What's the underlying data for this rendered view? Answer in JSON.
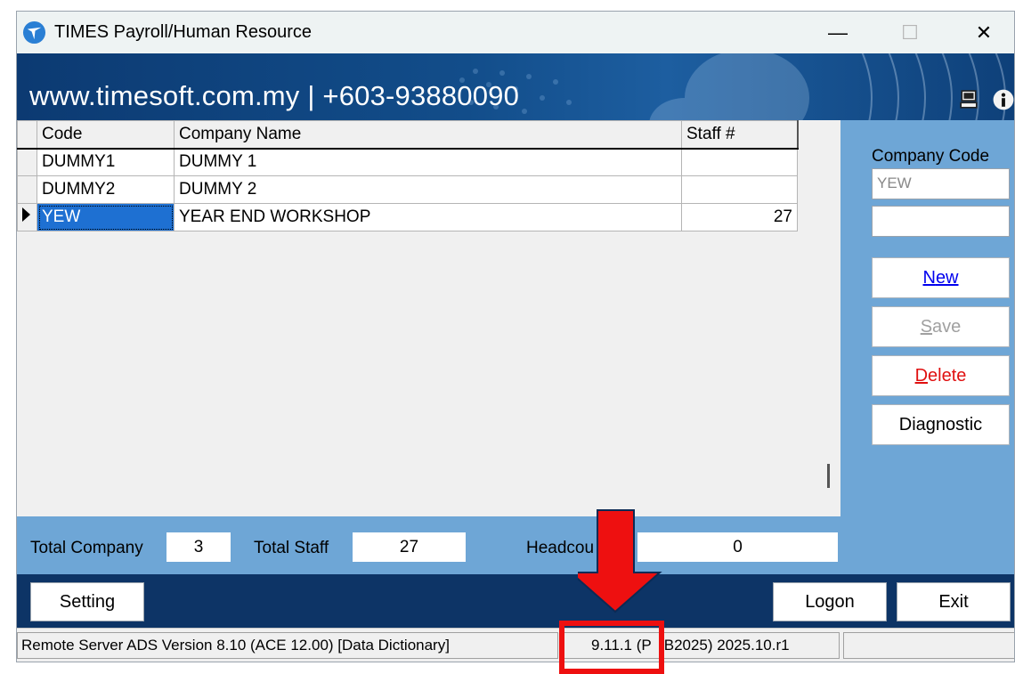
{
  "window": {
    "title": "TIMES Payroll/Human Resource",
    "controls": {
      "minimize": "—",
      "maximize": "☐",
      "close": "✕"
    }
  },
  "banner": {
    "contact": "www.timesoft.com.my | +603-93880090",
    "icons": [
      "computer-icon",
      "info-icon"
    ]
  },
  "grid": {
    "columns": [
      "Code",
      "Company Name",
      "Staff #"
    ],
    "rows": [
      {
        "code": "DUMMY1",
        "name": "DUMMY 1",
        "staff": ""
      },
      {
        "code": "DUMMY2",
        "name": "DUMMY 2",
        "staff": ""
      },
      {
        "code": "YEW",
        "name": "YEAR END WORKSHOP",
        "staff": "27",
        "selected": true
      }
    ]
  },
  "side_panel": {
    "company_code_label": "Company Code",
    "company_code_value": "YEW",
    "second_field_value": "",
    "buttons": {
      "new": {
        "hotkey": "N",
        "rest": "ew"
      },
      "save": {
        "hotkey": "S",
        "rest": "ave"
      },
      "delete": {
        "hotkey": "D",
        "rest": "elete"
      },
      "diagnostic": "Diagnostic"
    }
  },
  "totals": {
    "total_company_label": "Total Company",
    "total_company_value": "3",
    "total_staff_label": "Total Staff",
    "total_staff_value": "27",
    "headcount_label": "Headcou",
    "headcount_value": "0"
  },
  "bottom_buttons": {
    "setting": "Setting",
    "logon": "Logon",
    "exit": "Exit"
  },
  "status_bar": {
    "server": "Remote Server ADS Version 8.10 (ACE 12.00) [Data Dictionary]",
    "version_a": "9.11.1 (P",
    "version_b": "B2025) 2025.10.r1",
    "extra": ""
  },
  "colors": {
    "banner": "#0c3a72",
    "panel": "#6ea6d6",
    "bottom": "#0d3466",
    "selection": "#1e70d2",
    "annotation": "#ee1010"
  }
}
